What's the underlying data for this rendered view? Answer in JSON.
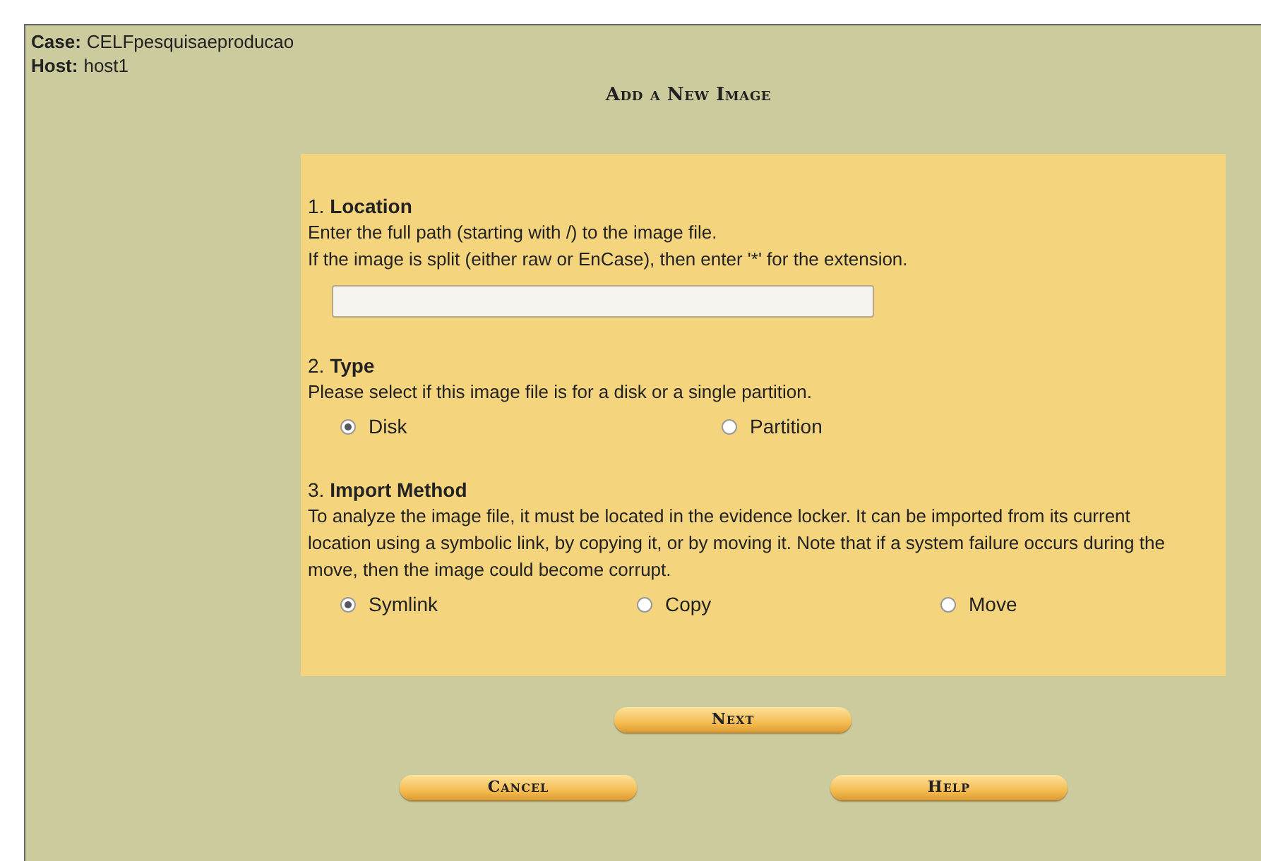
{
  "case": {
    "label": "Case:",
    "value": "CELFpesquisaeproducao"
  },
  "host": {
    "label": "Host:",
    "value": "host1"
  },
  "title": "Add a New Image",
  "sections": [
    {
      "number": "1.",
      "heading": "Location",
      "lines": [
        "Enter the full path (starting with /) to the image file.",
        "If the image is split (either raw or EnCase), then enter '*' for the extension."
      ],
      "kind": "text-field"
    },
    {
      "number": "2.",
      "heading": "Type",
      "lines": [
        "Please select if this image file is for a disk or a single partition."
      ],
      "kind": "radio-group",
      "options": [
        {
          "label": "Disk",
          "selected": true
        },
        {
          "label": "Partition",
          "selected": false
        }
      ]
    },
    {
      "number": "3.",
      "heading": "Import Method",
      "lines": [
        "To analyze the image file, it must be located in the evidence locker. It can be imported from its current location using a symbolic link, by copying it, or by moving it. Note that if a system failure occurs during the move, then the image could become corrupt."
      ],
      "kind": "radio-group",
      "options": [
        {
          "label": "Symlink",
          "selected": true
        },
        {
          "label": "Copy",
          "selected": false
        },
        {
          "label": "Move",
          "selected": false
        }
      ]
    }
  ],
  "next_button": "Next",
  "buttons": [
    "Cancel",
    "Help"
  ]
}
